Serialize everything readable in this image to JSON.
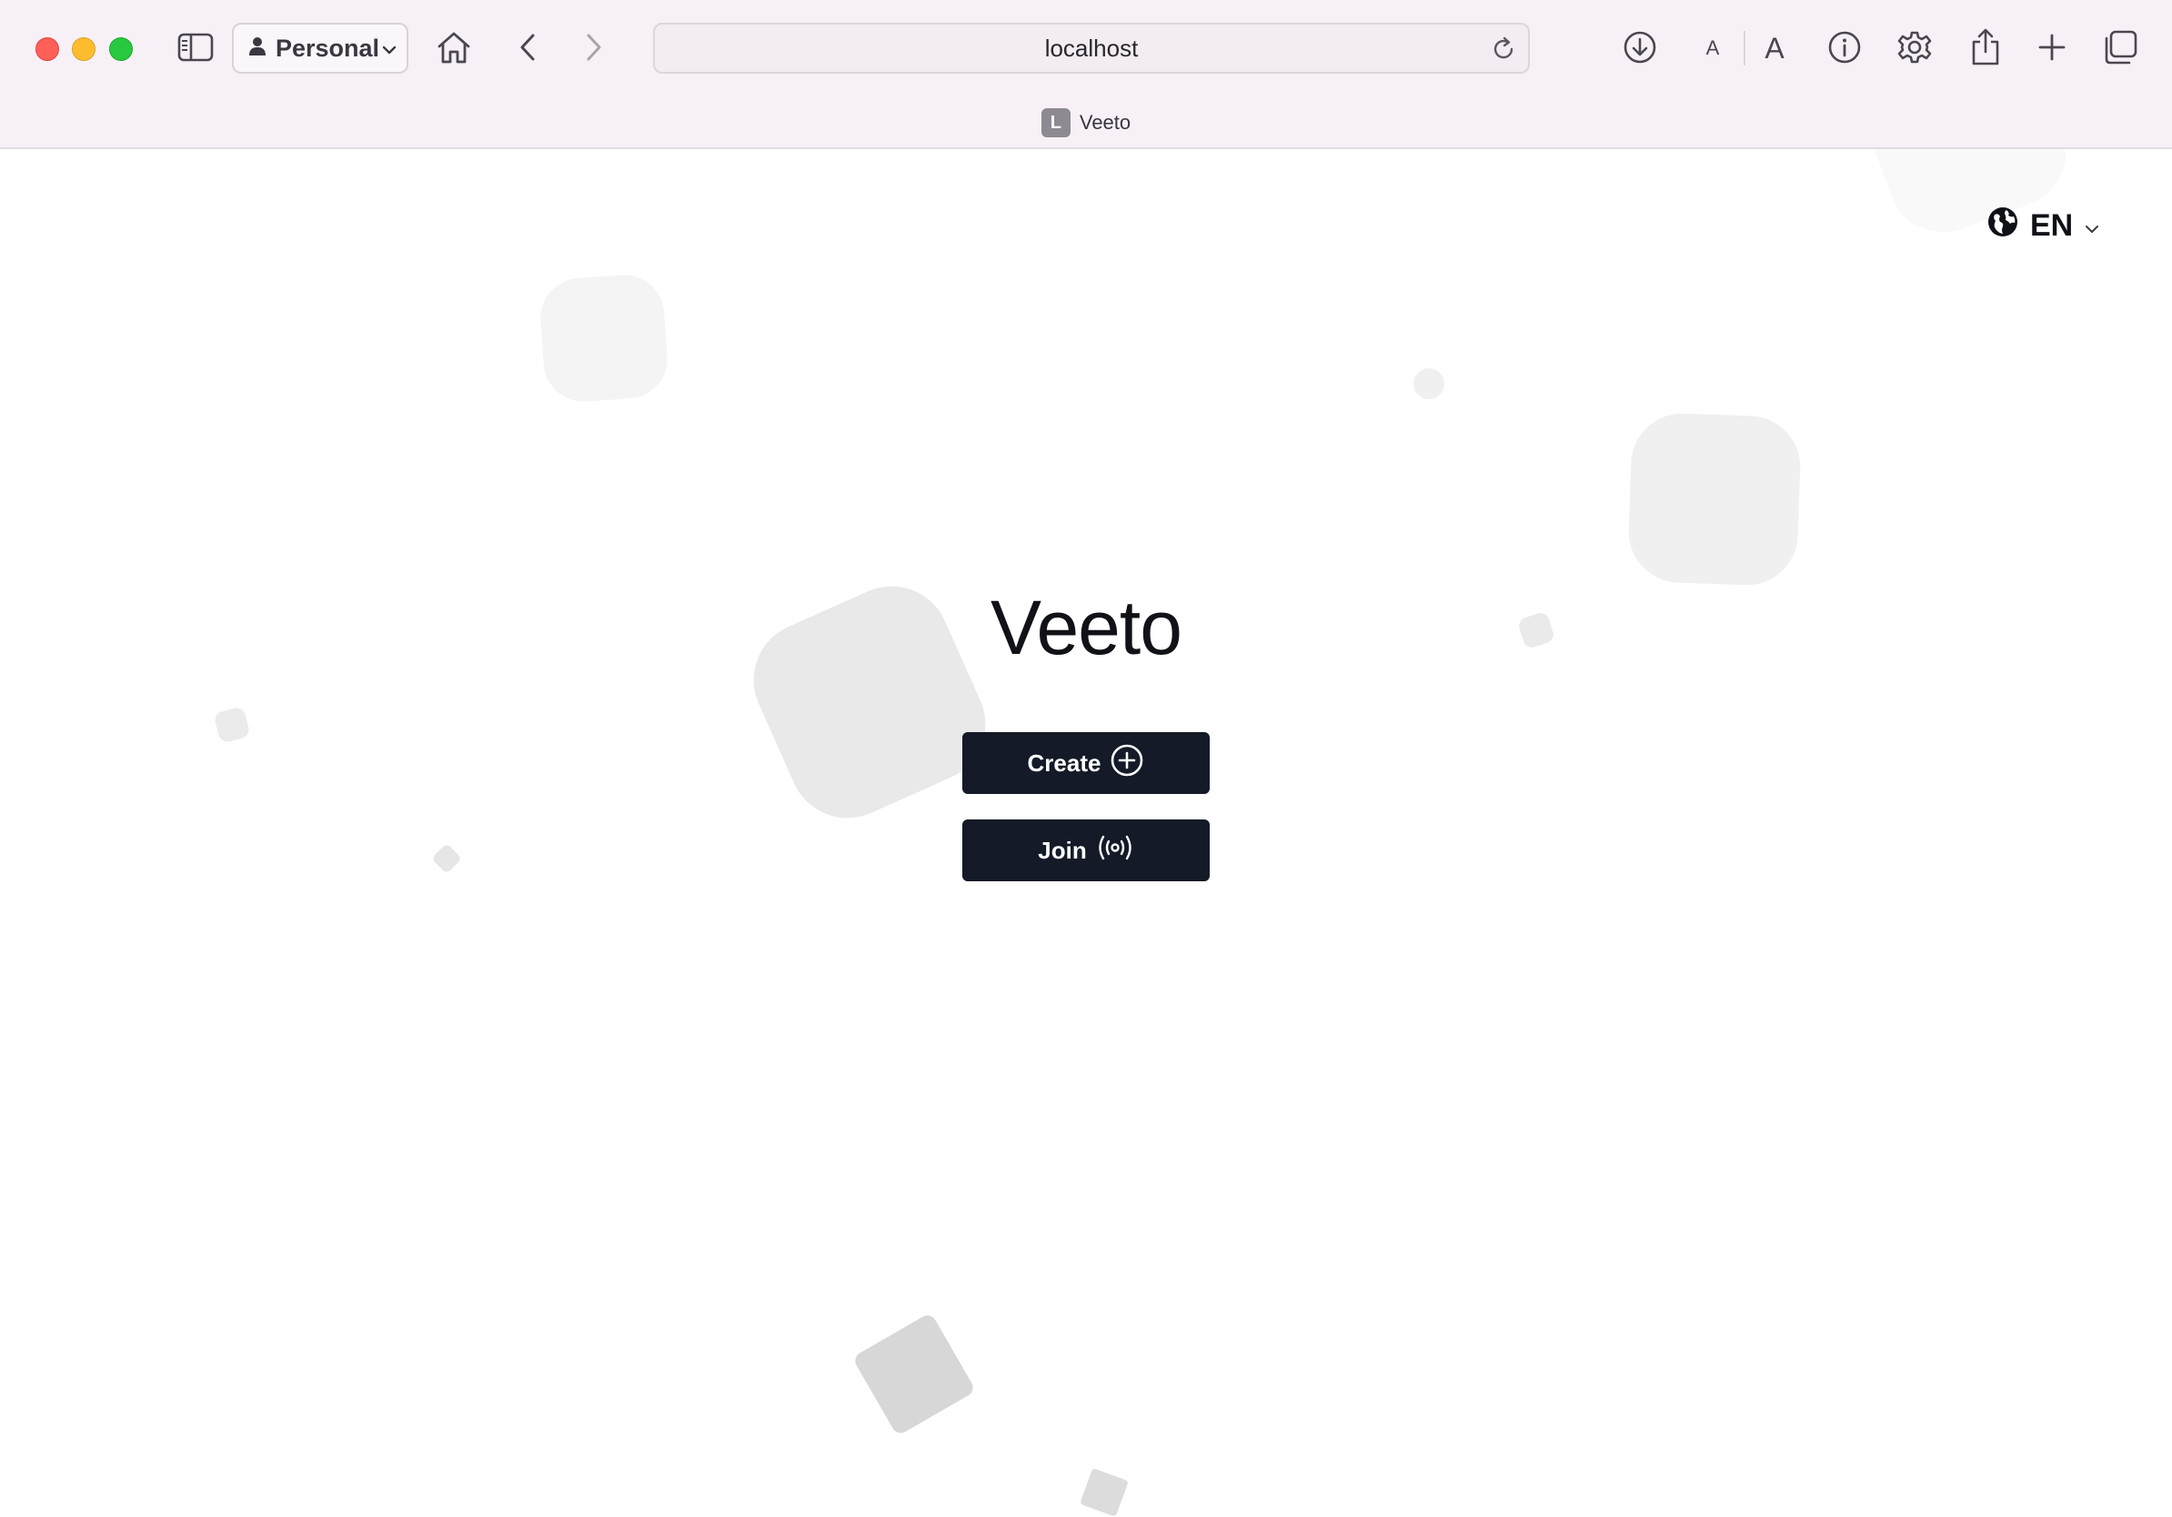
{
  "browser": {
    "profile_label": "Personal",
    "url": "localhost",
    "tab_title": "Veeto",
    "tab_favicon_letter": "L"
  },
  "page": {
    "language_label": "EN",
    "app_title": "Veeto",
    "create_label": "Create",
    "join_label": "Join"
  },
  "colors": {
    "chrome_background": "#f7f1f7",
    "button_background": "#141a27",
    "button_text": "#ffffff",
    "shape_fill": "#f2f2f2"
  },
  "icons": {
    "sidebar": "sidebar-icon",
    "home": "home-icon",
    "back": "chevron-left-icon",
    "forward": "chevron-right-icon",
    "download": "download-icon",
    "info": "info-icon",
    "settings": "gear-icon",
    "share": "share-icon",
    "new_tab": "plus-icon",
    "tab_overview": "tabs-icon",
    "language": "globe-icon",
    "create": "plus-circle-icon",
    "join": "broadcast-icon"
  }
}
